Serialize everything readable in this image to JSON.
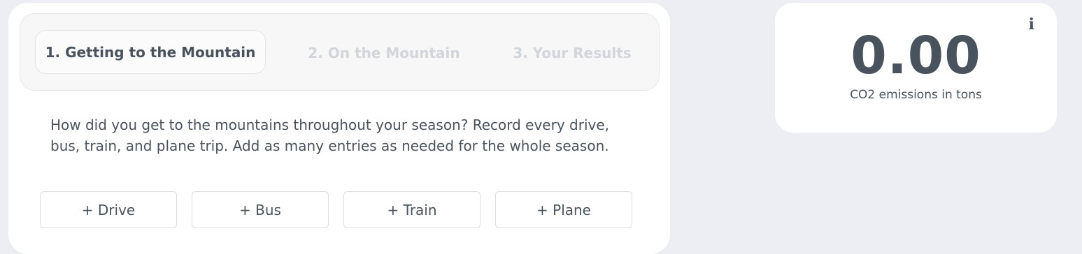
{
  "steps": [
    {
      "label": "1. Getting to the Mountain"
    },
    {
      "label": "2. On the Mountain"
    },
    {
      "label": "3. Your Results"
    }
  ],
  "intro_text": "How did you get to the mountains throughout your season? Record every drive, bus, train, and plane trip. Add as many entries as needed for the whole season.",
  "add_buttons": {
    "drive": "+ Drive",
    "bus": "+ Bus",
    "train": "+ Train",
    "plane": "+ Plane"
  },
  "result": {
    "value": "0.00",
    "unit_label": "CO2 emissions in tons",
    "info_icon": "i"
  },
  "colors": {
    "page_background": "#eceef3",
    "card_background": "#ffffff",
    "text_primary": "#48535d",
    "text_inactive": "#d2d5d9"
  }
}
